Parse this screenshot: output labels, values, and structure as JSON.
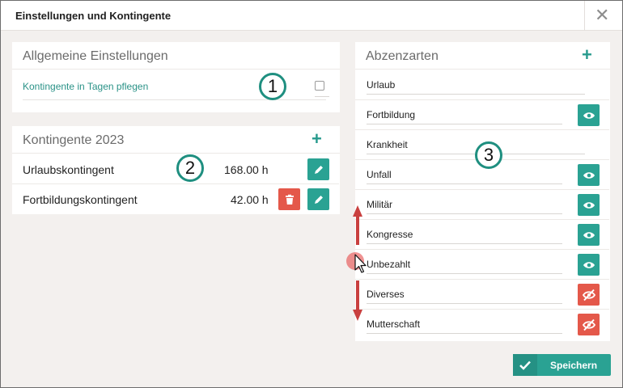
{
  "window": {
    "title": "Einstellungen und Kontingente",
    "close_glyph": "✕"
  },
  "general": {
    "title": "Allgemeine Einstellungen",
    "setting_label": "Kontingente in Tagen pflegen",
    "checked": false
  },
  "kontingente": {
    "title": "Kontingente 2023",
    "add_glyph": "+",
    "rows": [
      {
        "label": "Urlaubskontingent",
        "value": "168.00 h",
        "deletable": false
      },
      {
        "label": "Fortbildungskontingent",
        "value": "42.00 h",
        "deletable": true
      }
    ]
  },
  "absences": {
    "title": "Abzenzarten",
    "add_glyph": "+",
    "rows": [
      {
        "label": "Urlaub",
        "visibility": "none"
      },
      {
        "label": "Fortbildung",
        "visibility": "visible"
      },
      {
        "label": "Krankheit",
        "visibility": "none"
      },
      {
        "label": "Unfall",
        "visibility": "visible"
      },
      {
        "label": "Militär",
        "visibility": "visible"
      },
      {
        "label": "Kongresse",
        "visibility": "visible"
      },
      {
        "label": "Unbezahlt",
        "visibility": "visible"
      },
      {
        "label": "Diverses",
        "visibility": "hidden"
      },
      {
        "label": "Mutterschaft",
        "visibility": "hidden"
      }
    ]
  },
  "annotations": {
    "badge1": "1",
    "badge2": "2",
    "badge3": "3"
  },
  "footer": {
    "save_label": "Speichern"
  },
  "colors": {
    "accent": "#2aa293",
    "danger": "#e4584a",
    "arrow": "#c9403f"
  }
}
